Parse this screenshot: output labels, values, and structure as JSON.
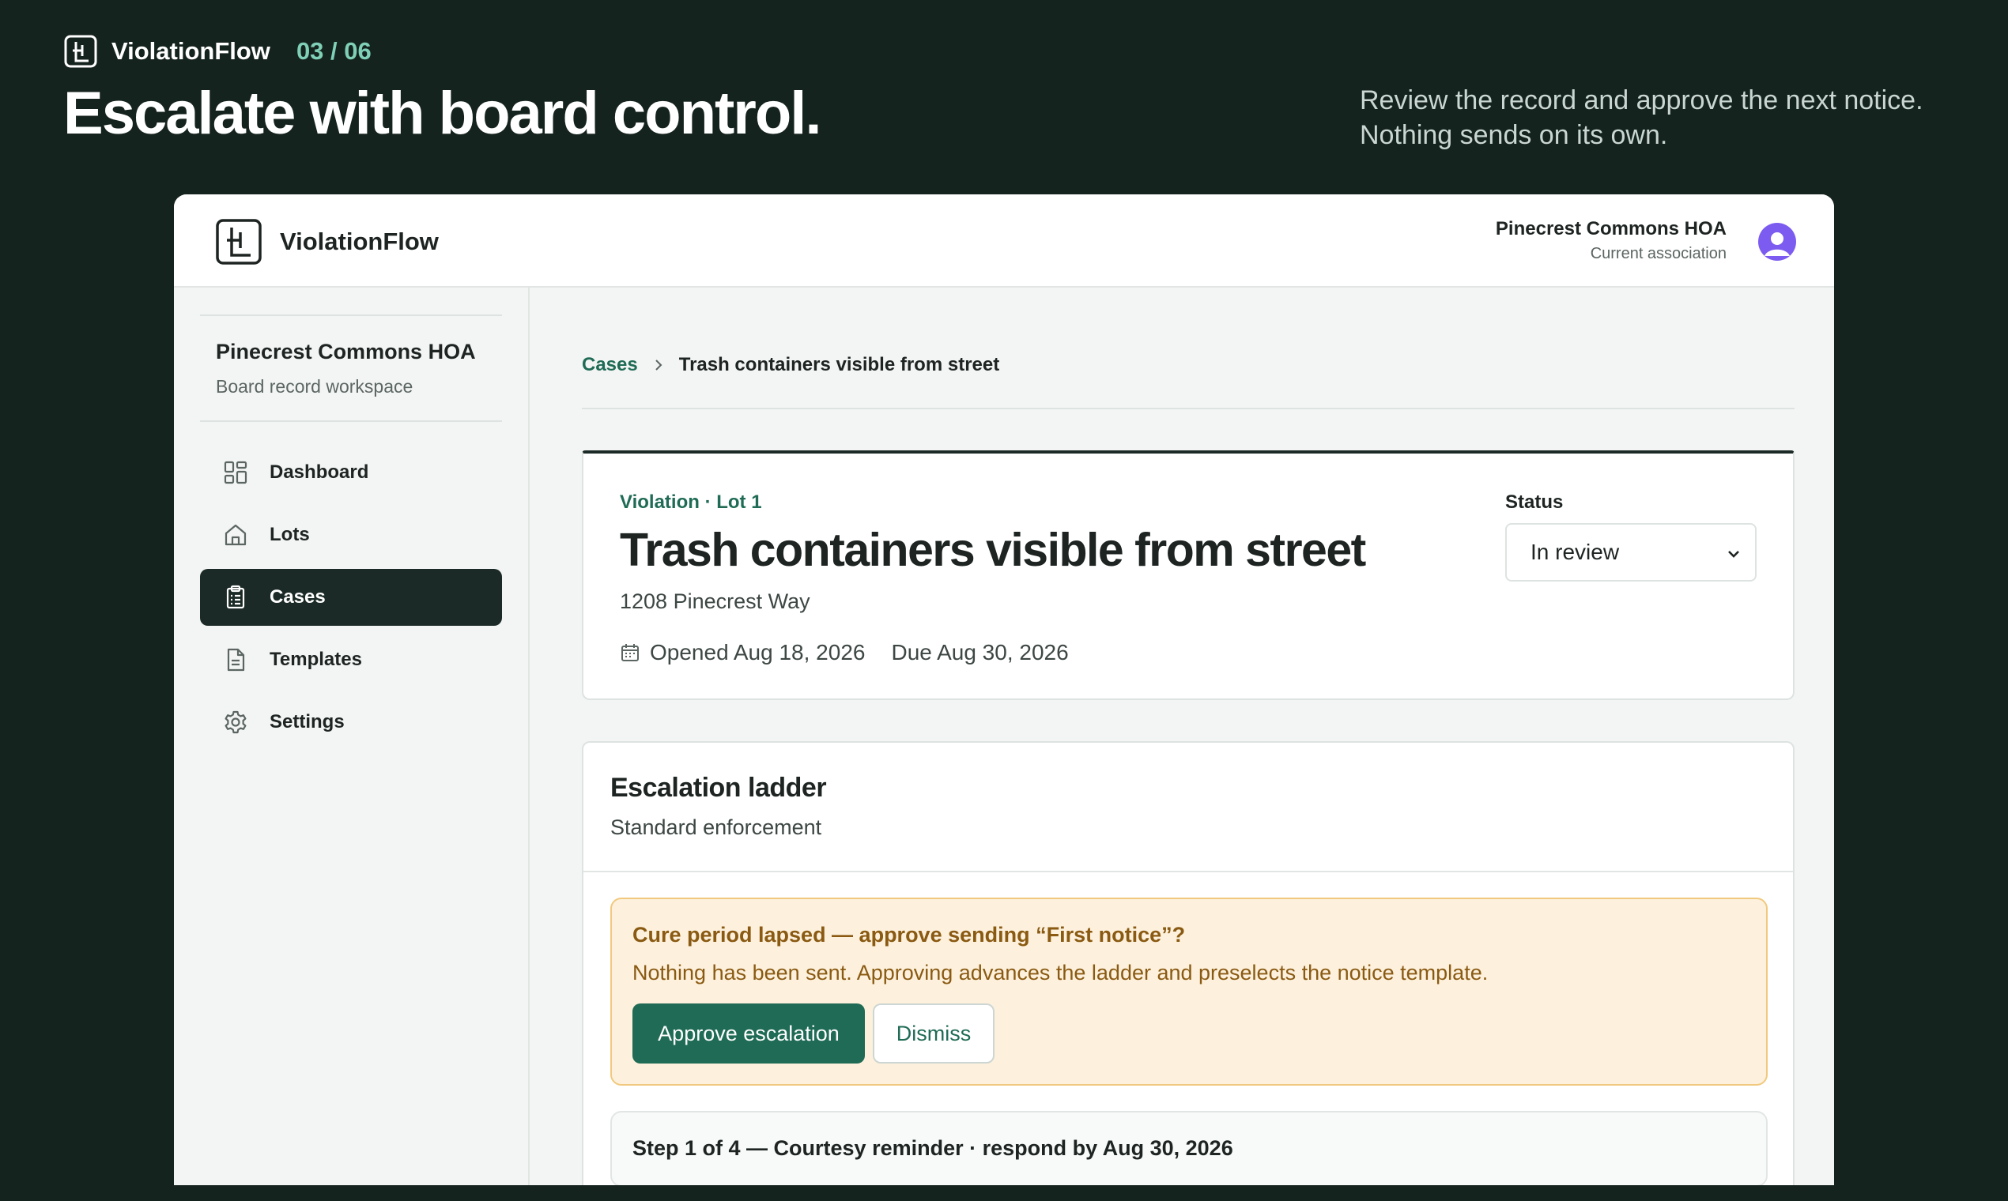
{
  "hero": {
    "brand": "ViolationFlow",
    "step": "03 / 06",
    "title": "Escalate with board control.",
    "subtitle_line1": "Review the record and approve the next notice.",
    "subtitle_line2": "Nothing sends on its own."
  },
  "topbar": {
    "brand": "ViolationFlow",
    "association_name": "Pinecrest Commons HOA",
    "association_label": "Current association",
    "avatar_icon": "user-avatar-icon"
  },
  "sidebar": {
    "workspace_name": "Pinecrest Commons HOA",
    "workspace_sub": "Board record workspace",
    "items": [
      {
        "label": "Dashboard",
        "icon": "grid-icon",
        "active": false
      },
      {
        "label": "Lots",
        "icon": "home-icon",
        "active": false
      },
      {
        "label": "Cases",
        "icon": "clipboard-icon",
        "active": true
      },
      {
        "label": "Templates",
        "icon": "document-icon",
        "active": false
      },
      {
        "label": "Settings",
        "icon": "gear-icon",
        "active": false
      }
    ]
  },
  "breadcrumb": {
    "parent": "Cases",
    "current": "Trash containers visible from street"
  },
  "case": {
    "eyebrow": "Violation · Lot 1",
    "title": "Trash containers visible from street",
    "address": "1208 Pinecrest Way",
    "opened": "Opened Aug 18, 2026",
    "due": "Due Aug 30, 2026",
    "status_label": "Status",
    "status_value": "In review"
  },
  "ladder": {
    "title": "Escalation ladder",
    "subtitle": "Standard enforcement",
    "alert_title": "Cure period lapsed — approve sending “First notice”?",
    "alert_body": "Nothing has been sent. Approving advances the ladder and preselects the notice template.",
    "approve_label": "Approve escalation",
    "dismiss_label": "Dismiss",
    "step_text": "Step 1 of 4 — Courtesy reminder · respond by Aug 30, 2026"
  },
  "colors": {
    "background": "#15231f",
    "accent": "#1f6b55",
    "accent_light": "#7fd0b6",
    "sidebar_active": "#1b2a26",
    "alert_bg": "#fdf1dd",
    "alert_border": "#f1c97e",
    "alert_text": "#8a5a12",
    "avatar": "#7c5cf0"
  }
}
